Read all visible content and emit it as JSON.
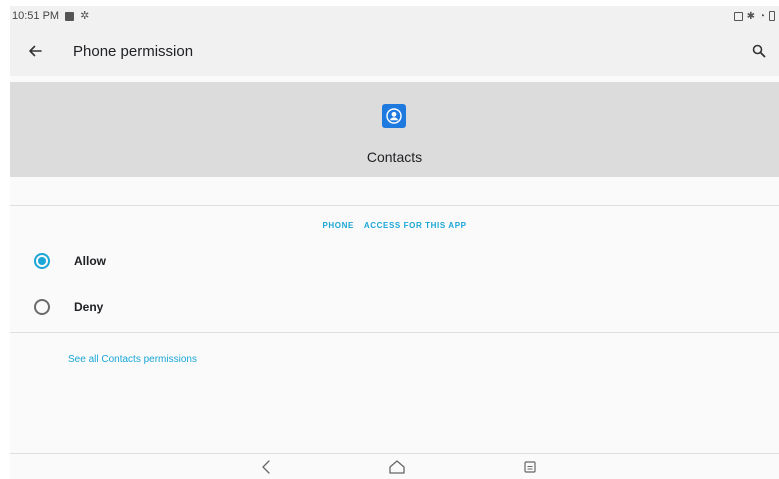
{
  "status_bar": {
    "time": "10:51 PM"
  },
  "app_bar": {
    "title": "Phone permission"
  },
  "header": {
    "app_name": "Contacts"
  },
  "section": {
    "label_part1": "PHONE",
    "label_part2": "ACCESS FOR THIS APP"
  },
  "options": [
    {
      "label": "Allow",
      "selected": true
    },
    {
      "label": "Deny",
      "selected": false
    }
  ],
  "link": {
    "label": "See all Contacts permissions"
  },
  "colors": {
    "accent": "#1aa6d6",
    "app_icon": "#1f7ae0",
    "header_band": "#dcdcdc"
  },
  "icons": [
    "back-arrow-icon",
    "search-icon",
    "contacts-icon",
    "nav-back-icon",
    "nav-home-icon",
    "nav-recents-icon"
  ]
}
